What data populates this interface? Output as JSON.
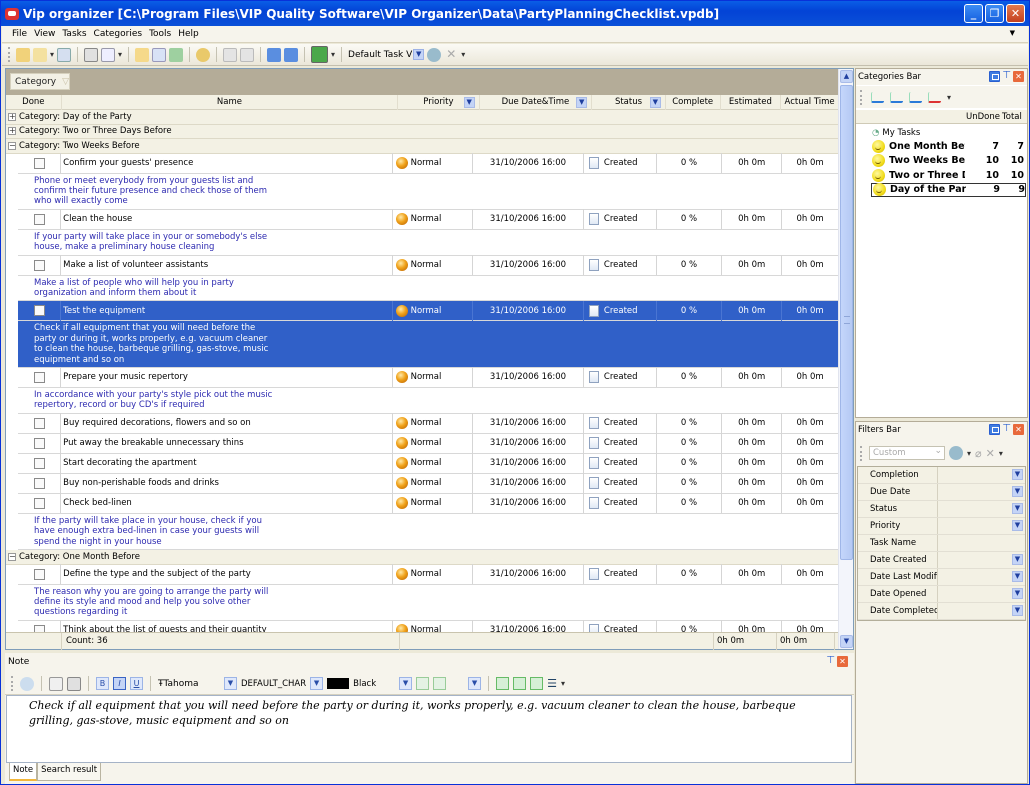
{
  "window": {
    "title": "Vip organizer [C:\\Program Files\\VIP Quality Software\\VIP Organizer\\Data\\PartyPlanningChecklist.vpdb]",
    "controls": [
      "minimize",
      "restore",
      "close"
    ]
  },
  "menu": [
    "File",
    "View",
    "Tasks",
    "Categories",
    "Tools",
    "Help"
  ],
  "toolbar": {
    "view_combo": "Default Task V",
    "icons": [
      "open-database-icon",
      "new-database-icon",
      "save-icon",
      "print-icon",
      "print-preview-icon",
      "new-task-icon",
      "edit-task-icon",
      "new-subtask-icon",
      "find-icon",
      "move-up-icon",
      "move-down-icon",
      "collapse-icon",
      "expand-icon",
      "view-icon",
      "apply-view-icon",
      "delete-view-icon"
    ]
  },
  "grid": {
    "group_chip": "Category",
    "columns": [
      "Done",
      "Name",
      "Priority",
      "Due Date&Time",
      "Status",
      "Complete",
      "Estimated Time",
      "Actual Time"
    ],
    "categories": [
      {
        "label": "Category: Day of the Party",
        "expanded": false,
        "tasks": []
      },
      {
        "label": "Category: Two or Three Days Before",
        "expanded": false,
        "tasks": []
      },
      {
        "label": "Category: Two Weeks Before",
        "expanded": true,
        "tasks": [
          {
            "name": "Confirm your guests' presence",
            "priority": "Normal",
            "due": "31/10/2006 16:00",
            "status": "Created",
            "complete": "0 %",
            "est": "0h 0m",
            "act": "0h 0m",
            "note": "Phone or meet everybody from your guests list and confirm their future presence and check those of them who will exactly come",
            "selected": false
          },
          {
            "name": "Clean the house",
            "priority": "Normal",
            "due": "31/10/2006 16:00",
            "status": "Created",
            "complete": "0 %",
            "est": "0h 0m",
            "act": "0h 0m",
            "note": "If your party will take place in your or somebody's else house, make a preliminary house cleaning",
            "selected": false
          },
          {
            "name": "Make a list of volunteer assistants",
            "priority": "Normal",
            "due": "31/10/2006 16:00",
            "status": "Created",
            "complete": "0 %",
            "est": "0h 0m",
            "act": "0h 0m",
            "note": "Make a list of people who will help you in party organization and inform them about it",
            "selected": false
          },
          {
            "name": "Test the equipment",
            "priority": "Normal",
            "due": "31/10/2006 16:00",
            "status": "Created",
            "complete": "0 %",
            "est": "0h 0m",
            "act": "0h 0m",
            "note": "Check if all equipment that you will need before the party or during it, works properly, e.g. vacuum cleaner to clean the house, barbeque grilling, gas-stove, music equipment and so on",
            "selected": true
          },
          {
            "name": "Prepare your music repertory",
            "priority": "Normal",
            "due": "31/10/2006 16:00",
            "status": "Created",
            "complete": "0 %",
            "est": "0h 0m",
            "act": "0h 0m",
            "note": "In accordance with your party's style pick out the music repertory, record or buy CD's if required",
            "selected": false
          },
          {
            "name": "Buy required decorations, flowers and so on",
            "priority": "Normal",
            "due": "31/10/2006 16:00",
            "status": "Created",
            "complete": "0 %",
            "est": "0h 0m",
            "act": "0h 0m",
            "note": "",
            "selected": false
          },
          {
            "name": "Put away the breakable unnecessary thins",
            "priority": "Normal",
            "due": "31/10/2006 16:00",
            "status": "Created",
            "complete": "0 %",
            "est": "0h 0m",
            "act": "0h 0m",
            "note": "",
            "selected": false
          },
          {
            "name": "Start decorating the apartment",
            "priority": "Normal",
            "due": "31/10/2006 16:00",
            "status": "Created",
            "complete": "0 %",
            "est": "0h 0m",
            "act": "0h 0m",
            "note": "",
            "selected": false
          },
          {
            "name": "Buy non-perishable foods and drinks",
            "priority": "Normal",
            "due": "31/10/2006 16:00",
            "status": "Created",
            "complete": "0 %",
            "est": "0h 0m",
            "act": "0h 0m",
            "note": "",
            "selected": false
          },
          {
            "name": "Check bed-linen",
            "priority": "Normal",
            "due": "31/10/2006 16:00",
            "status": "Created",
            "complete": "0 %",
            "est": "0h 0m",
            "act": "0h 0m",
            "note": "If the party will take place in your house, check if you have enough extra bed-linen in case your guests will spend the night in your house",
            "selected": false
          }
        ]
      },
      {
        "label": "Category: One Month Before",
        "expanded": true,
        "tasks": [
          {
            "name": "Define the type and the subject of the party",
            "priority": "Normal",
            "due": "31/10/2006 16:00",
            "status": "Created",
            "complete": "0 %",
            "est": "0h 0m",
            "act": "0h 0m",
            "note": "The reason why you are going to arrange the party will define its style and mood and help you solve other questions regarding it",
            "selected": false
          },
          {
            "name": "Think about the list of guests and their quantity",
            "priority": "Normal",
            "due": "31/10/2006 16:00",
            "status": "Created",
            "complete": "0 %",
            "est": "0h 0m",
            "act": "0h 0m",
            "note": "",
            "selected": false
          }
        ]
      }
    ],
    "footer": {
      "count": "Count: 36",
      "est_total": "0h 0m",
      "act_total": "0h 0m"
    }
  },
  "note_pane": {
    "title": "Note",
    "font": "Tahoma",
    "charset": "DEFAULT_CHAR",
    "color": "Black",
    "text": "Check if all equipment that you will need before the party or during it, works properly, e.g. vacuum cleaner to clean the house, barbeque grilling, gas-stove, music equipment and so on",
    "tabs": [
      "Note",
      "Search result"
    ],
    "active_tab": "Note"
  },
  "categories_bar": {
    "title": "Categories Bar",
    "col_undone": "UnDone",
    "col_total": "Total",
    "root": "My Tasks",
    "items": [
      {
        "name": "One Month Befo",
        "undone": "7",
        "total": "7"
      },
      {
        "name": "Two Weeks Bef",
        "undone": "10",
        "total": "10"
      },
      {
        "name": "Two or Three D.",
        "undone": "10",
        "total": "10"
      },
      {
        "name": "Day of the Party",
        "undone": "9",
        "total": "9",
        "selected": true
      }
    ]
  },
  "filters_bar": {
    "title": "Filters Bar",
    "preset": "Custom",
    "filters": [
      {
        "label": "Completion",
        "dropdown": true
      },
      {
        "label": "Due Date",
        "dropdown": true
      },
      {
        "label": "Status",
        "dropdown": true
      },
      {
        "label": "Priority",
        "dropdown": true
      },
      {
        "label": "Task Name",
        "dropdown": false
      },
      {
        "label": "Date Created",
        "dropdown": true
      },
      {
        "label": "Date Last Modific",
        "dropdown": true
      },
      {
        "label": "Date Opened",
        "dropdown": true
      },
      {
        "label": "Date Completed",
        "dropdown": true
      }
    ]
  }
}
